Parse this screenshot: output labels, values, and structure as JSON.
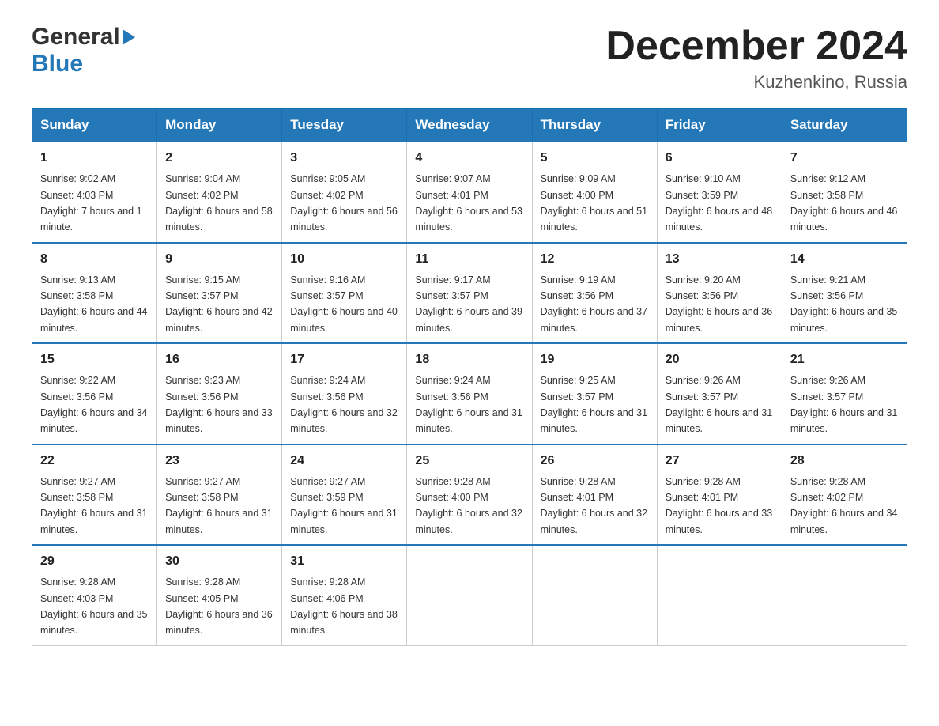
{
  "header": {
    "logo_general": "General",
    "logo_blue": "Blue",
    "month_year": "December 2024",
    "location": "Kuzhenkino, Russia"
  },
  "days_of_week": [
    "Sunday",
    "Monday",
    "Tuesday",
    "Wednesday",
    "Thursday",
    "Friday",
    "Saturday"
  ],
  "weeks": [
    [
      {
        "day": "1",
        "sunrise": "9:02 AM",
        "sunset": "4:03 PM",
        "daylight": "7 hours and 1 minute."
      },
      {
        "day": "2",
        "sunrise": "9:04 AM",
        "sunset": "4:02 PM",
        "daylight": "6 hours and 58 minutes."
      },
      {
        "day": "3",
        "sunrise": "9:05 AM",
        "sunset": "4:02 PM",
        "daylight": "6 hours and 56 minutes."
      },
      {
        "day": "4",
        "sunrise": "9:07 AM",
        "sunset": "4:01 PM",
        "daylight": "6 hours and 53 minutes."
      },
      {
        "day": "5",
        "sunrise": "9:09 AM",
        "sunset": "4:00 PM",
        "daylight": "6 hours and 51 minutes."
      },
      {
        "day": "6",
        "sunrise": "9:10 AM",
        "sunset": "3:59 PM",
        "daylight": "6 hours and 48 minutes."
      },
      {
        "day": "7",
        "sunrise": "9:12 AM",
        "sunset": "3:58 PM",
        "daylight": "6 hours and 46 minutes."
      }
    ],
    [
      {
        "day": "8",
        "sunrise": "9:13 AM",
        "sunset": "3:58 PM",
        "daylight": "6 hours and 44 minutes."
      },
      {
        "day": "9",
        "sunrise": "9:15 AM",
        "sunset": "3:57 PM",
        "daylight": "6 hours and 42 minutes."
      },
      {
        "day": "10",
        "sunrise": "9:16 AM",
        "sunset": "3:57 PM",
        "daylight": "6 hours and 40 minutes."
      },
      {
        "day": "11",
        "sunrise": "9:17 AM",
        "sunset": "3:57 PM",
        "daylight": "6 hours and 39 minutes."
      },
      {
        "day": "12",
        "sunrise": "9:19 AM",
        "sunset": "3:56 PM",
        "daylight": "6 hours and 37 minutes."
      },
      {
        "day": "13",
        "sunrise": "9:20 AM",
        "sunset": "3:56 PM",
        "daylight": "6 hours and 36 minutes."
      },
      {
        "day": "14",
        "sunrise": "9:21 AM",
        "sunset": "3:56 PM",
        "daylight": "6 hours and 35 minutes."
      }
    ],
    [
      {
        "day": "15",
        "sunrise": "9:22 AM",
        "sunset": "3:56 PM",
        "daylight": "6 hours and 34 minutes."
      },
      {
        "day": "16",
        "sunrise": "9:23 AM",
        "sunset": "3:56 PM",
        "daylight": "6 hours and 33 minutes."
      },
      {
        "day": "17",
        "sunrise": "9:24 AM",
        "sunset": "3:56 PM",
        "daylight": "6 hours and 32 minutes."
      },
      {
        "day": "18",
        "sunrise": "9:24 AM",
        "sunset": "3:56 PM",
        "daylight": "6 hours and 31 minutes."
      },
      {
        "day": "19",
        "sunrise": "9:25 AM",
        "sunset": "3:57 PM",
        "daylight": "6 hours and 31 minutes."
      },
      {
        "day": "20",
        "sunrise": "9:26 AM",
        "sunset": "3:57 PM",
        "daylight": "6 hours and 31 minutes."
      },
      {
        "day": "21",
        "sunrise": "9:26 AM",
        "sunset": "3:57 PM",
        "daylight": "6 hours and 31 minutes."
      }
    ],
    [
      {
        "day": "22",
        "sunrise": "9:27 AM",
        "sunset": "3:58 PM",
        "daylight": "6 hours and 31 minutes."
      },
      {
        "day": "23",
        "sunrise": "9:27 AM",
        "sunset": "3:58 PM",
        "daylight": "6 hours and 31 minutes."
      },
      {
        "day": "24",
        "sunrise": "9:27 AM",
        "sunset": "3:59 PM",
        "daylight": "6 hours and 31 minutes."
      },
      {
        "day": "25",
        "sunrise": "9:28 AM",
        "sunset": "4:00 PM",
        "daylight": "6 hours and 32 minutes."
      },
      {
        "day": "26",
        "sunrise": "9:28 AM",
        "sunset": "4:01 PM",
        "daylight": "6 hours and 32 minutes."
      },
      {
        "day": "27",
        "sunrise": "9:28 AM",
        "sunset": "4:01 PM",
        "daylight": "6 hours and 33 minutes."
      },
      {
        "day": "28",
        "sunrise": "9:28 AM",
        "sunset": "4:02 PM",
        "daylight": "6 hours and 34 minutes."
      }
    ],
    [
      {
        "day": "29",
        "sunrise": "9:28 AM",
        "sunset": "4:03 PM",
        "daylight": "6 hours and 35 minutes."
      },
      {
        "day": "30",
        "sunrise": "9:28 AM",
        "sunset": "4:05 PM",
        "daylight": "6 hours and 36 minutes."
      },
      {
        "day": "31",
        "sunrise": "9:28 AM",
        "sunset": "4:06 PM",
        "daylight": "6 hours and 38 minutes."
      },
      null,
      null,
      null,
      null
    ]
  ],
  "labels": {
    "sunrise": "Sunrise:",
    "sunset": "Sunset:",
    "daylight": "Daylight:"
  }
}
